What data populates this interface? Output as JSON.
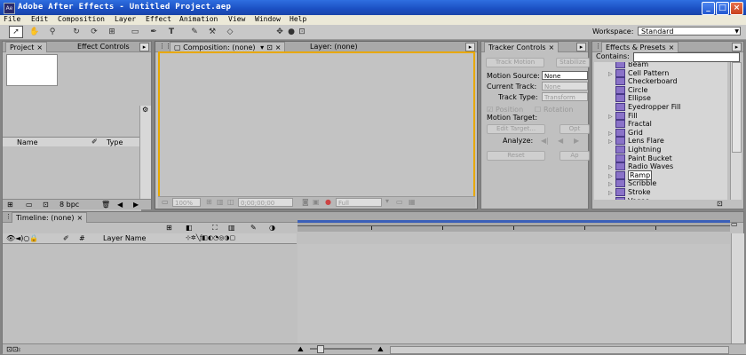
{
  "window": {
    "title": "Adobe After Effects - Untitled Project.aep",
    "app_icon": "Ae",
    "minimize": "_",
    "maximize": "□",
    "close": "×"
  },
  "menu": [
    "File",
    "Edit",
    "Composition",
    "Layer",
    "Effect",
    "Animation",
    "View",
    "Window",
    "Help"
  ],
  "toolbar": {
    "tools": [
      "selection-tool",
      "hand-tool",
      "zoom-tool",
      "rotation-tool",
      "orbit-camera-tool",
      "pan-behind-tool",
      "mask-tool",
      "pen-tool",
      "type-tool",
      "brush-tool",
      "clone-stamp-tool",
      "eraser-tool"
    ],
    "workspace_label": "Workspace:",
    "workspace_value": "Standard"
  },
  "project_panel": {
    "tabs": [
      "Project",
      "Effect Controls"
    ],
    "columns": [
      "Name",
      "Type"
    ],
    "bpc": "8 bpc"
  },
  "composition_panel": {
    "tabs": [
      "Composition: (none)",
      "Layer: (none)"
    ],
    "zoom": "100%",
    "timecode": "0;00;00;00",
    "resolution": "Full"
  },
  "tracker_panel": {
    "title": "Tracker Controls",
    "buttons": [
      "Track Motion",
      "Stabilize"
    ],
    "motion_source_label": "Motion Source:",
    "motion_source_value": "None",
    "current_track_label": "Current Track:",
    "current_track_value": "None",
    "track_type_label": "Track Type:",
    "track_type_value": "Transform",
    "position_label": "Position",
    "rotation_label": "Rotation",
    "motion_target_label": "Motion Target:",
    "edit_target": "Edit Target...",
    "options": "Opt",
    "analyze_label": "Analyze:",
    "reset": "Reset",
    "apply": "Ap"
  },
  "effects_panel": {
    "title": "Effects & Presets",
    "contains_label": "Contains:",
    "contains_value": "",
    "items": [
      {
        "name": "Beam",
        "twirl": false,
        "selected": false
      },
      {
        "name": "Cell Pattern",
        "twirl": true,
        "selected": false
      },
      {
        "name": "Checkerboard",
        "twirl": false,
        "selected": false
      },
      {
        "name": "Circle",
        "twirl": false,
        "selected": false
      },
      {
        "name": "Ellipse",
        "twirl": false,
        "selected": false
      },
      {
        "name": "Eyedropper Fill",
        "twirl": false,
        "selected": false
      },
      {
        "name": "Fill",
        "twirl": true,
        "selected": false
      },
      {
        "name": "Fractal",
        "twirl": false,
        "selected": false
      },
      {
        "name": "Grid",
        "twirl": true,
        "selected": false
      },
      {
        "name": "Lens Flare",
        "twirl": true,
        "selected": false
      },
      {
        "name": "Lightning",
        "twirl": false,
        "selected": false
      },
      {
        "name": "Paint Bucket",
        "twirl": false,
        "selected": false
      },
      {
        "name": "Radio Waves",
        "twirl": true,
        "selected": false
      },
      {
        "name": "Ramp",
        "twirl": true,
        "selected": true
      },
      {
        "name": "Scribble",
        "twirl": true,
        "selected": false
      },
      {
        "name": "Stroke",
        "twirl": true,
        "selected": false
      },
      {
        "name": "Vegas",
        "twirl": true,
        "selected": false
      }
    ]
  },
  "timeline_panel": {
    "tab": "Timeline: (none)",
    "columns": [
      "#",
      "Layer Name"
    ]
  }
}
